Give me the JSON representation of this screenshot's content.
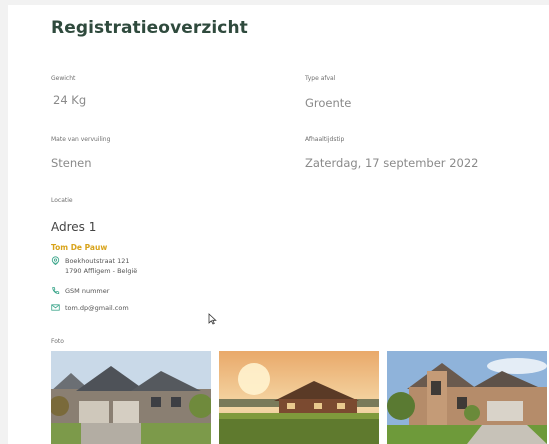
{
  "page": {
    "title": "Registratieoverzicht"
  },
  "fields": {
    "gewicht": {
      "label": "Gewicht",
      "value": "24 Kg"
    },
    "type_afval": {
      "label": "Type afval",
      "value": "Groente"
    },
    "mate_vervuiling": {
      "label": "Mate van vervuiling",
      "value": "Stenen"
    },
    "afhaaltijdstip": {
      "label": "Afhaaltijdstip",
      "value": "Zaterdag, 17 september 2022"
    },
    "locatie": {
      "label": "Locatie"
    }
  },
  "address": {
    "title": "Adres 1",
    "name": "Tom De Pauw",
    "street": "Boekhoutstraat 121",
    "city": "1790 Affligem - België",
    "phone": "GSM nummer",
    "email": "tom.dp@gmail.com"
  },
  "photos": {
    "label": "Foto",
    "items": [
      "house-photo-1",
      "house-photo-2",
      "house-photo-3"
    ]
  },
  "colors": {
    "title": "#2f4a3d",
    "accent_green": "#3aa58a",
    "name_gold": "#d8a31a"
  },
  "icons": {
    "location": "location-pin-icon",
    "phone": "phone-icon",
    "email": "envelope-icon",
    "cursor": "mouse-cursor-icon"
  }
}
